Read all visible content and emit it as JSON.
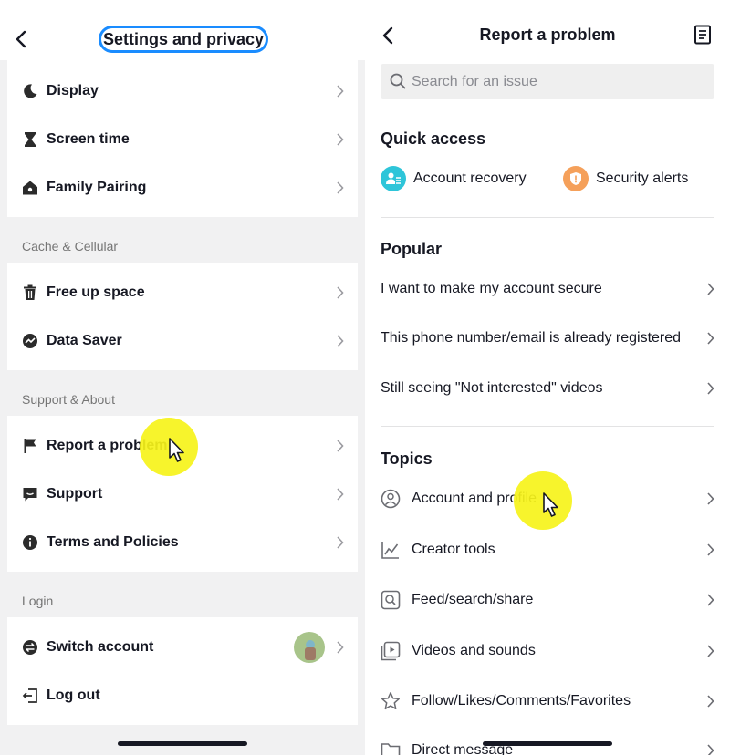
{
  "left": {
    "title": "Settings and privacy",
    "card1": [
      {
        "label": "Display",
        "icon": "moon-icon"
      },
      {
        "label": "Screen time",
        "icon": "hourglass-icon"
      },
      {
        "label": "Family Pairing",
        "icon": "home-icon"
      }
    ],
    "section_cache": "Cache & Cellular",
    "card2": [
      {
        "label": "Free up space",
        "icon": "trash-icon"
      },
      {
        "label": "Data Saver",
        "icon": "data-saver-icon"
      }
    ],
    "section_support": "Support & About",
    "card3": [
      {
        "label": "Report a problem",
        "icon": "flag-icon"
      },
      {
        "label": "Support",
        "icon": "chat-icon"
      },
      {
        "label": "Terms and Policies",
        "icon": "info-icon"
      }
    ],
    "section_login": "Login",
    "card4": [
      {
        "label": "Switch account",
        "icon": "switch-icon"
      },
      {
        "label": "Log out",
        "icon": "logout-icon"
      }
    ]
  },
  "right": {
    "title": "Report a problem",
    "search_placeholder": "Search for an issue",
    "quick_access_heading": "Quick access",
    "quick_access": [
      {
        "label": "Account recovery",
        "icon": "account-recovery-icon",
        "color": "#2ec5d9"
      },
      {
        "label": "Security alerts",
        "icon": "shield-icon",
        "color": "#f5a05a"
      }
    ],
    "popular_heading": "Popular",
    "popular": [
      "I want to make my account secure",
      "This phone number/email is already registered",
      "Still seeing \"Not interested\" videos"
    ],
    "topics_heading": "Topics",
    "topics": [
      {
        "label": "Account and profile",
        "icon": "user-circle-icon"
      },
      {
        "label": "Creator tools",
        "icon": "chart-icon"
      },
      {
        "label": "Feed/search/share",
        "icon": "search-box-icon"
      },
      {
        "label": "Videos and sounds",
        "icon": "video-icon"
      },
      {
        "label": "Follow/Likes/Comments/Favorites",
        "icon": "star-icon"
      },
      {
        "label": "Direct message",
        "icon": "folder-icon"
      }
    ]
  },
  "colors": {
    "accent": "#1a8cff",
    "highlight": "#f6f31a"
  }
}
